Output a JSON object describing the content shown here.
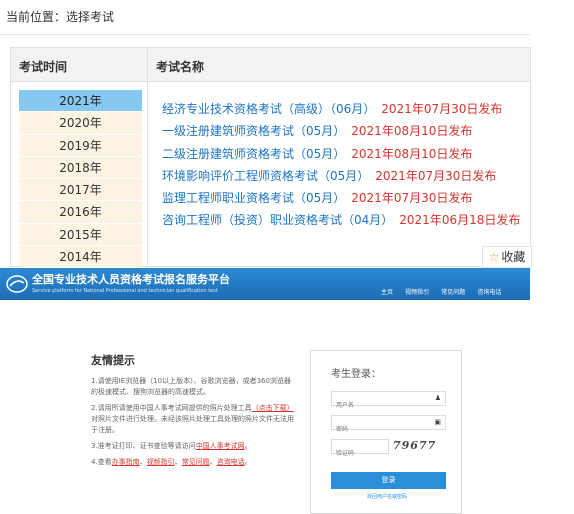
{
  "breadcrumb": "当前位置：选择考试",
  "table": {
    "col_year": "考试时间",
    "col_name": "考试名称"
  },
  "years": [
    "2021年",
    "2020年",
    "2019年",
    "2018年",
    "2017年",
    "2016年",
    "2015年",
    "2014年"
  ],
  "selected_year": "2021年",
  "exams": [
    {
      "name": "经济专业技术资格考试（高级）（06月）",
      "date": "2021年07月30日发布"
    },
    {
      "name": "一级注册建筑师资格考试（05月）",
      "date": "2021年08月10日发布"
    },
    {
      "name": "二级注册建筑师资格考试（05月）",
      "date": "2021年08月10日发布"
    },
    {
      "name": "环境影响评价工程师资格考试（05月）",
      "date": "2021年07月30日发布"
    },
    {
      "name": "监理工程师职业资格考试（05月）",
      "date": "2021年07月30日发布"
    },
    {
      "name": "咨询工程师（投资）职业资格考试（04月）",
      "date": "2021年06月18日发布"
    }
  ],
  "favorite": {
    "icon": "star-icon",
    "label": "收藏"
  },
  "portal": {
    "title": "全国专业技术人员资格考试报名服务平台",
    "subtitle": "Service platform for National Professional and technician qualification test",
    "nav": [
      "主页",
      "视频指引",
      "常见问题",
      "咨询电话"
    ],
    "colors": {
      "header": "#1c6db5",
      "button": "#2a8fd6"
    }
  },
  "tips": {
    "title": "友情提示",
    "items": {
      "t1": "1.请使用IE浏览器（10以上版本）、谷歌浏览器，或者360浏览器的极速模式、搜狗浏览器的高速模式。",
      "t2a": "2.请用所请使用中国人事考试网提供的照片处理工具",
      "t2link": "（点击下载）",
      "t2b": "对照片文件进行处理。未经该照片处理工具处理的照片文件无法用于注册。",
      "t3a": "3.准考证打印、证书查验等请访问",
      "t3link": "中国人事考试网",
      "t3b": "。",
      "t4a": "4.查看",
      "t4l1": "办事指南",
      "t4l2": "视频指引",
      "t4l3": "常见问题",
      "t4l4": "咨询电话",
      "sep": "、",
      "end": "。"
    }
  },
  "login": {
    "title": "考生登录：",
    "user_placeholder": "用户名",
    "pass_placeholder": "密码",
    "captcha_placeholder": "验证码",
    "captcha_text": "79677",
    "button": "登录",
    "forgot": "找回用户名或密码"
  }
}
